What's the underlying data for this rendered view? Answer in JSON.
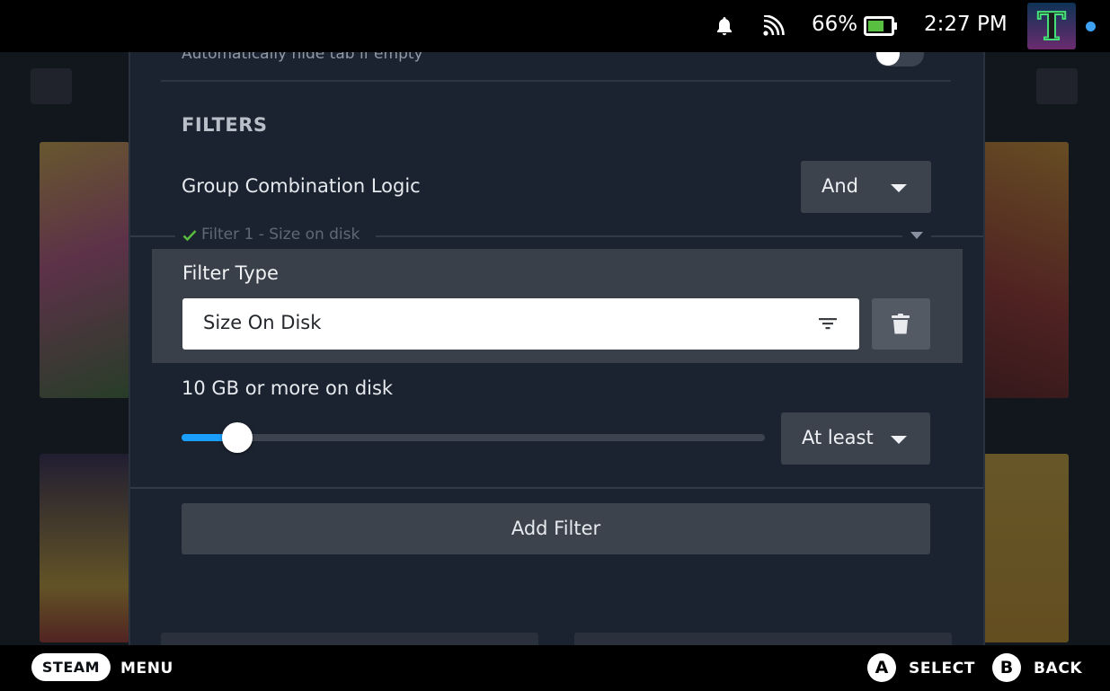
{
  "status_bar": {
    "battery_percent": "66%",
    "time": "2:27 PM",
    "avatar_letter": "T",
    "icons": [
      "bell-icon",
      "wifi-icon",
      "battery-icon"
    ]
  },
  "panel": {
    "hide_empty_label": "Automatically hide tab if empty",
    "hide_empty_toggle": false,
    "filters_section_title": "FILTERS",
    "group_logic_label": "Group Combination Logic",
    "group_logic_value": "And",
    "filter_legend": "Filter 1 - Size on disk",
    "filter_type_label": "Filter Type",
    "filter_type_value": "Size On Disk",
    "size_label": "10 GB or more on disk",
    "slider_value_fraction": 0.07,
    "comparison_value": "At least",
    "add_filter_label": "Add Filter"
  },
  "bottom_bar": {
    "steam_label": "STEAM",
    "menu_label": "MENU",
    "a_glyph": "A",
    "select_label": "SELECT",
    "b_glyph": "B",
    "back_label": "BACK"
  },
  "colors": {
    "accent": "#1a9fff",
    "panel_bg": "#1b2330",
    "check_green": "#59bf40"
  }
}
